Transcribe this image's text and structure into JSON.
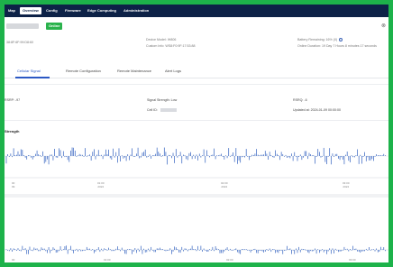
{
  "nav": {
    "items": [
      "Map",
      "Overview",
      "Config",
      "Firmware",
      "Edge Computing",
      "Administration"
    ],
    "active_index": 1
  },
  "header": {
    "status": "Online",
    "close_glyph": "⊗"
  },
  "meta": {
    "left_sub": "38:8F:6F:99:D8:60",
    "center_line1": "Device Model: IH806",
    "center_line2": "Custom Info: WS8:F0:9F:17:53:88",
    "right_line1": "Battery Remaining: 16% (0)",
    "right_line2": "Online Duration: 19 Day 7 Hours 8 minutes 17 seconds"
  },
  "tabs": [
    "Cellular Signal",
    "Remote Configuration",
    "Remote Maintenance",
    "Alert Logs"
  ],
  "signal": {
    "rsrp_label": "RSRP: -97",
    "strength_label": "Signal Strength: Low",
    "cell_id_label": "Cell ID:",
    "rsrq_label": "RSRQ: -6",
    "updated_label": "Updated at: 2024-01-09 00:00:00"
  },
  "chart1": {
    "title": "Strength",
    "ticks": [
      {
        "l1": "00",
        "l2": "09"
      },
      {
        "l1": "01:00",
        "l2": "2024"
      },
      {
        "l1": "02:00",
        "l2": "2024"
      },
      {
        "l1": "03:00",
        "l2": "2024"
      }
    ]
  },
  "chart2": {
    "ticks": [
      "00",
      "01:00",
      "02:00",
      "03:00"
    ]
  },
  "colors": {
    "border": "#1db24a",
    "nav_bg": "#0d2247",
    "accent": "#2b58c4",
    "series": "#2f5fbf",
    "online": "#2ab24c"
  }
}
